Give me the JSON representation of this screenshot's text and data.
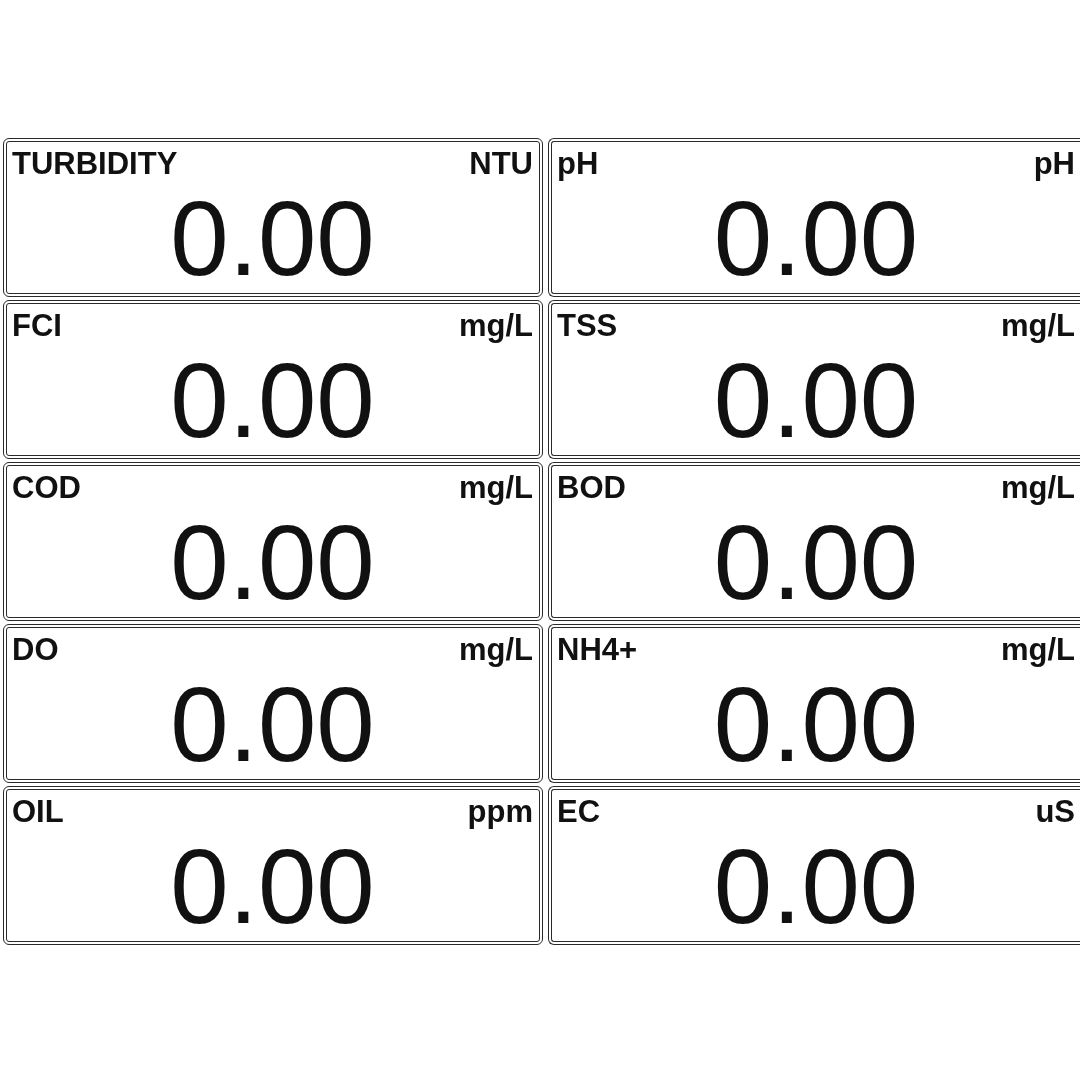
{
  "panels": [
    {
      "name": "TURBIDITY",
      "unit": "NTU",
      "value": "0.00"
    },
    {
      "name": "pH",
      "unit": "pH",
      "value": "0.00"
    },
    {
      "name": "FCI",
      "unit": "mg/L",
      "value": "0.00"
    },
    {
      "name": "TSS",
      "unit": "mg/L",
      "value": "0.00"
    },
    {
      "name": "COD",
      "unit": "mg/L",
      "value": "0.00"
    },
    {
      "name": "BOD",
      "unit": "mg/L",
      "value": "0.00"
    },
    {
      "name": "DO",
      "unit": "mg/L",
      "value": "0.00"
    },
    {
      "name": "NH4+",
      "unit": "mg/L",
      "value": "0.00"
    },
    {
      "name": "OIL",
      "unit": "ppm",
      "value": "0.00"
    },
    {
      "name": "EC",
      "unit": "uS",
      "value": "0.00"
    }
  ]
}
